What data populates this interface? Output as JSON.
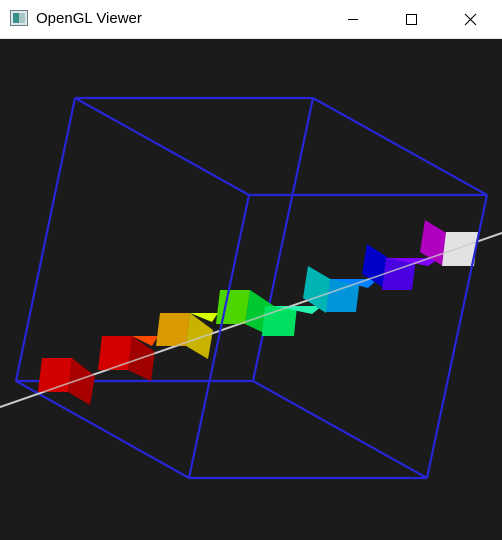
{
  "window": {
    "title": "OpenGL Viewer",
    "controls": {
      "minimize_icon": "minimize-icon",
      "maximize_icon": "maximize-icon",
      "close_icon": "close-icon"
    }
  },
  "viewport": {
    "background": "#1b1b1b",
    "box_color": "#2828d8",
    "axis_color": "#c8c8c8"
  }
}
